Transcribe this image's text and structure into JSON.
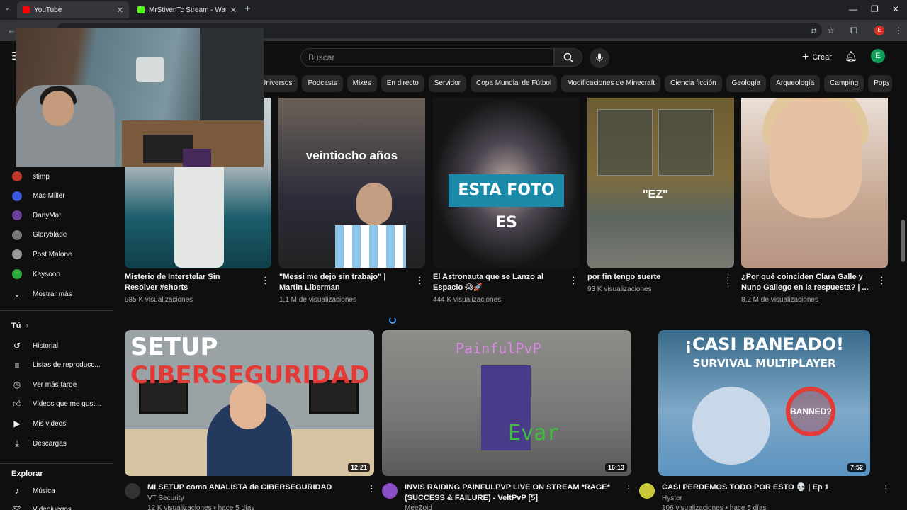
{
  "browser": {
    "tabs": [
      {
        "title": "YouTube",
        "active": true
      },
      {
        "title": "MrStivenTc Stream - Watch Live",
        "active": false
      }
    ],
    "profile_initial": "E"
  },
  "masthead": {
    "search_placeholder": "Buscar",
    "create_label": "Crear",
    "avatar_initial": "E"
  },
  "chips": [
    "Universos",
    "Pódcasts",
    "Mixes",
    "En directo",
    "Servidor",
    "Copa Mundial de Fútbol",
    "Modificaciones de Minecraft",
    "Ciencia ficción",
    "Geología",
    "Arqueología",
    "Camping",
    "Pop"
  ],
  "sidebar": {
    "subscriptions": [
      {
        "name": "stimp",
        "color": "#c0392b"
      },
      {
        "name": "Mac Miller",
        "color": "#3b5bdb"
      },
      {
        "name": "DanyMat",
        "color": "#6b3fa0"
      },
      {
        "name": "Gloryblade",
        "color": "#777777"
      },
      {
        "name": "Post Malone",
        "color": "#999999"
      },
      {
        "name": "Kaysooo",
        "color": "#2eaa3a"
      }
    ],
    "show_more": "Mostrar más",
    "you_heading": "Tú",
    "you_items": [
      {
        "label": "Historial",
        "icon": "history-icon"
      },
      {
        "label": "Listas de reproducc...",
        "icon": "playlist-icon"
      },
      {
        "label": "Ver más tarde",
        "icon": "watch-later-icon"
      },
      {
        "label": "Videos que me gust...",
        "icon": "like-icon"
      },
      {
        "label": "Mis videos",
        "icon": "my-videos-icon"
      },
      {
        "label": "Descargas",
        "icon": "download-icon"
      }
    ],
    "explore_heading": "Explorar",
    "explore_items": [
      {
        "label": "Música",
        "icon": "music-icon"
      },
      {
        "label": "Videojuegos",
        "icon": "gaming-icon"
      }
    ]
  },
  "shorts": [
    {
      "title": "Misterio de Interstelar Sin Resolver #shorts",
      "views": "985 K visualizaciones"
    },
    {
      "title": "\"Messi me dejo sin trabajo\" | Martin Liberman",
      "views": "1,1 M de visualizaciones",
      "caption": "veintiocho años"
    },
    {
      "title": "El Astronauta que se Lanzo al Espacio 😱🚀",
      "views": "444 K visualizaciones",
      "caption": "ESTA FOTO ES"
    },
    {
      "title": "por fin tengo suerte",
      "views": "93 K visualizaciones",
      "caption": "\"EZ\""
    },
    {
      "title": "¿Por qué coinciden Clara Galle y Nuno Gallego en la respuesta? | ...",
      "views": "8,2 M de visualizaciones"
    }
  ],
  "videos": [
    {
      "title": "MI SETUP como ANALISTA de CIBERSEGURIDAD",
      "channel": "VT Security",
      "meta": "12 K visualizaciones • hace 5 días",
      "duration": "12:21",
      "thumb_text_a": "SETUP",
      "thumb_text_b": "CIBERSEGURIDAD",
      "avatar_color": "#333333"
    },
    {
      "title": "INVIS RAIDING PAINFULPVP LIVE ON STREAM *RAGE* (SUCCESS & FAILURE) - VeltPvP [5]",
      "channel": "MeeZoid",
      "meta": "",
      "duration": "16:13",
      "thumb_text_a": "PainfulPvP",
      "thumb_text_b": "Evar",
      "avatar_color": "#8a4fc7"
    },
    {
      "title": "CASI PERDEMOS TODO POR ESTO 💀 | Ep 1",
      "channel": "Hyster",
      "meta": "106 visualizaciones • hace 5 días",
      "duration": "7:52",
      "thumb_text_a": "¡CASI BANEADO!",
      "thumb_text_b": "SURVIVAL MULTIPLAYER",
      "thumb_text_c": "BANNED?",
      "avatar_color": "#c9c93a"
    }
  ]
}
